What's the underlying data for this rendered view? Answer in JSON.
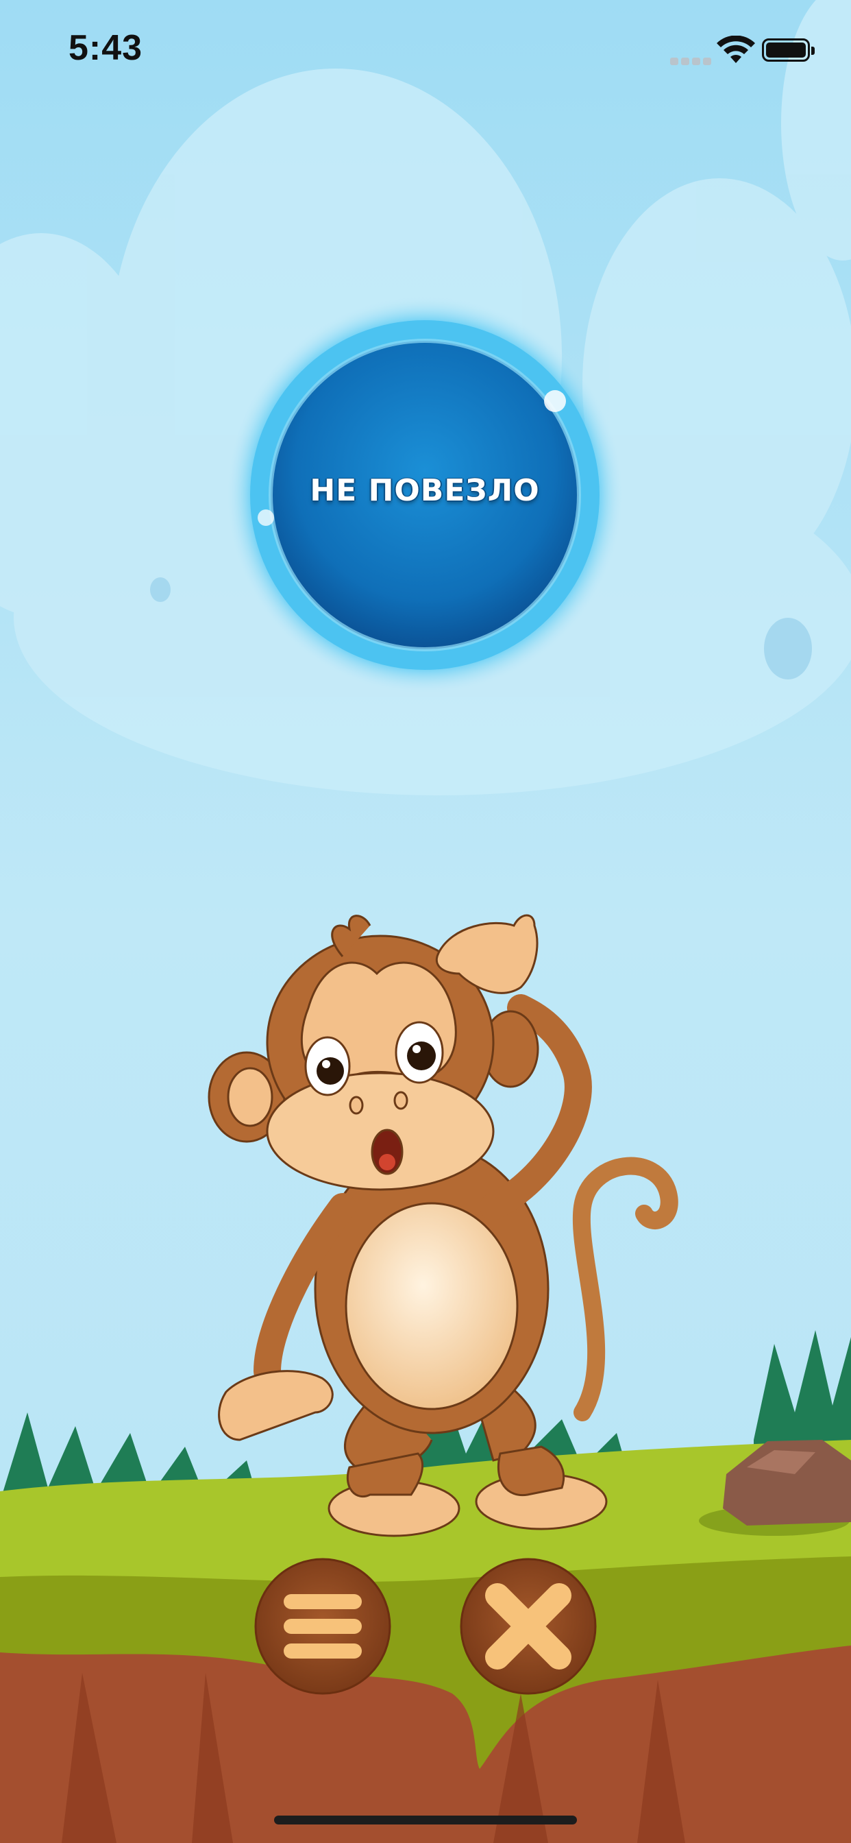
{
  "status_bar": {
    "time": "5:43",
    "icons": [
      "cellular-signal-icon",
      "wifi-icon",
      "battery-icon"
    ]
  },
  "result_bubble": {
    "text": "НЕ ПОВЕЗЛО"
  },
  "character": {
    "icon": "confused-monkey-icon"
  },
  "bottom_controls": {
    "menu_button_icon": "hamburger-menu-icon",
    "close_button_icon": "close-x-icon"
  },
  "colors": {
    "sky": "#bde6f6",
    "bubble": "#1377c4",
    "grass": "#a8c62b",
    "soil": "#a44f2f",
    "wood_button": "#8e4a22",
    "wood_icon": "#f7c27a"
  }
}
